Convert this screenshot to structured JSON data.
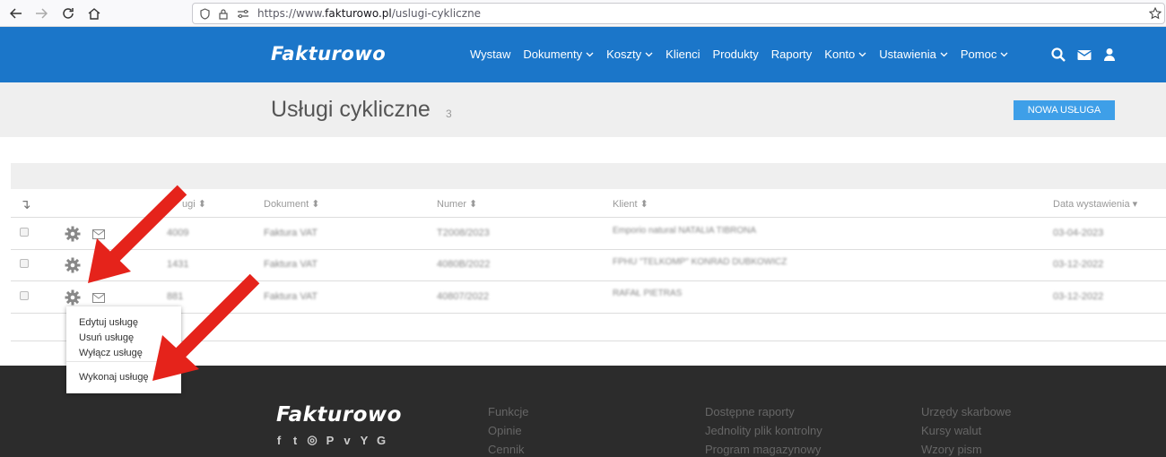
{
  "browser": {
    "url_prefix": "https://www.",
    "url_domain": "fakturowo.pl",
    "url_path": "/uslugi-cykliczne"
  },
  "header": {
    "logo": "Fakturowo",
    "nav": [
      "Wystaw",
      "Dokumenty",
      "Koszty",
      "Klienci",
      "Produkty",
      "Raporty",
      "Konto",
      "Ustawienia",
      "Pomoc"
    ],
    "nav_caret": [
      false,
      true,
      true,
      false,
      false,
      false,
      true,
      true,
      true
    ]
  },
  "page": {
    "title": "Usługi cykliczne",
    "count": "3",
    "new_button": "NOWA USŁUGA"
  },
  "table": {
    "sort_icon": "↴",
    "headers": {
      "id": "ugi ⬍",
      "document": "Dokument ⬍",
      "number": "Numer ⬍",
      "client": "Klient ⬍",
      "date": "Data wystawienia ▾"
    },
    "rows": [
      {
        "id": "4009",
        "document": "Faktura VAT",
        "number": "T2008/2023",
        "client": "Emporio natural NATALIA TIBRONA",
        "date": "03-04-2023"
      },
      {
        "id": "1431",
        "document": "Faktura VAT",
        "number": "4080B/2022",
        "client": "FPHU \"TELKOMP\" KONRAD DUBKOWICZ",
        "date": "03-12-2022"
      },
      {
        "id": "881",
        "document": "Faktura VAT",
        "number": "40807/2022",
        "client": "RAFAŁ PIETRAS",
        "date": "03-12-2022"
      }
    ]
  },
  "dropdown": {
    "items": [
      "Edytuj usługę",
      "Usuń usługę",
      "Wyłącz usługę",
      "Wykonaj usługę"
    ]
  },
  "footer": {
    "logo": "Fakturowo",
    "social": [
      "f",
      "t",
      "◎",
      "P",
      "v",
      "Y",
      "G"
    ],
    "col1": [
      "Funkcje",
      "Opinie",
      "Cennik"
    ],
    "col2": [
      "Dostępne raporty",
      "Jednolity plik kontrolny",
      "Program magazynowy"
    ],
    "col3": [
      "Urzędy skarbowe",
      "Kursy walut",
      "Wzory pism"
    ]
  },
  "colors": {
    "header_bg": "#1b76c9",
    "button_bg": "#3e9fe8",
    "footer_bg": "#2c2c2c",
    "arrow": "#e5231b"
  }
}
